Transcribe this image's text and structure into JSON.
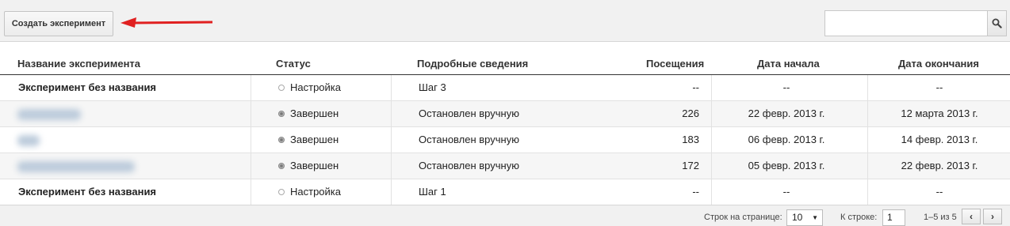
{
  "toolbar": {
    "create_label": "Создать эксперимент",
    "search_value": "",
    "search_icon": "search-icon",
    "accent_color": "#e02020"
  },
  "table": {
    "columns": [
      "Название эксперимента",
      "Статус",
      "Подробные сведения",
      "Посещения",
      "Дата начала",
      "Дата окончания"
    ],
    "rows": [
      {
        "name": "Эксперимент без названия",
        "status": "Настройка",
        "status_kind": "setup",
        "details": "Шаг 3",
        "visits": "--",
        "start": "--",
        "end": "--"
      },
      {
        "name": "",
        "status": "Завершен",
        "status_kind": "done",
        "details": "Остановлен вручную",
        "visits": "226",
        "start": "22 февр. 2013 г.",
        "end": "12 марта 2013 г."
      },
      {
        "name": "",
        "status": "Завершен",
        "status_kind": "done",
        "details": "Остановлен вручную",
        "visits": "183",
        "start": "06 февр. 2013 г.",
        "end": "14 февр. 2013 г."
      },
      {
        "name": "",
        "status": "Завершен",
        "status_kind": "done",
        "details": "Остановлен вручную",
        "visits": "172",
        "start": "05 февр. 2013 г.",
        "end": "22 февр. 2013 г."
      },
      {
        "name": "Эксперимент без названия",
        "status": "Настройка",
        "status_kind": "setup",
        "details": "Шаг 1",
        "visits": "--",
        "start": "--",
        "end": "--"
      }
    ]
  },
  "footer": {
    "rows_per_page_label": "Строк на странице:",
    "rows_per_page_value": "10",
    "goto_label": "К строке:",
    "goto_value": "1",
    "range_text": "1–5 из 5",
    "prev_glyph": "‹",
    "next_glyph": "›"
  }
}
